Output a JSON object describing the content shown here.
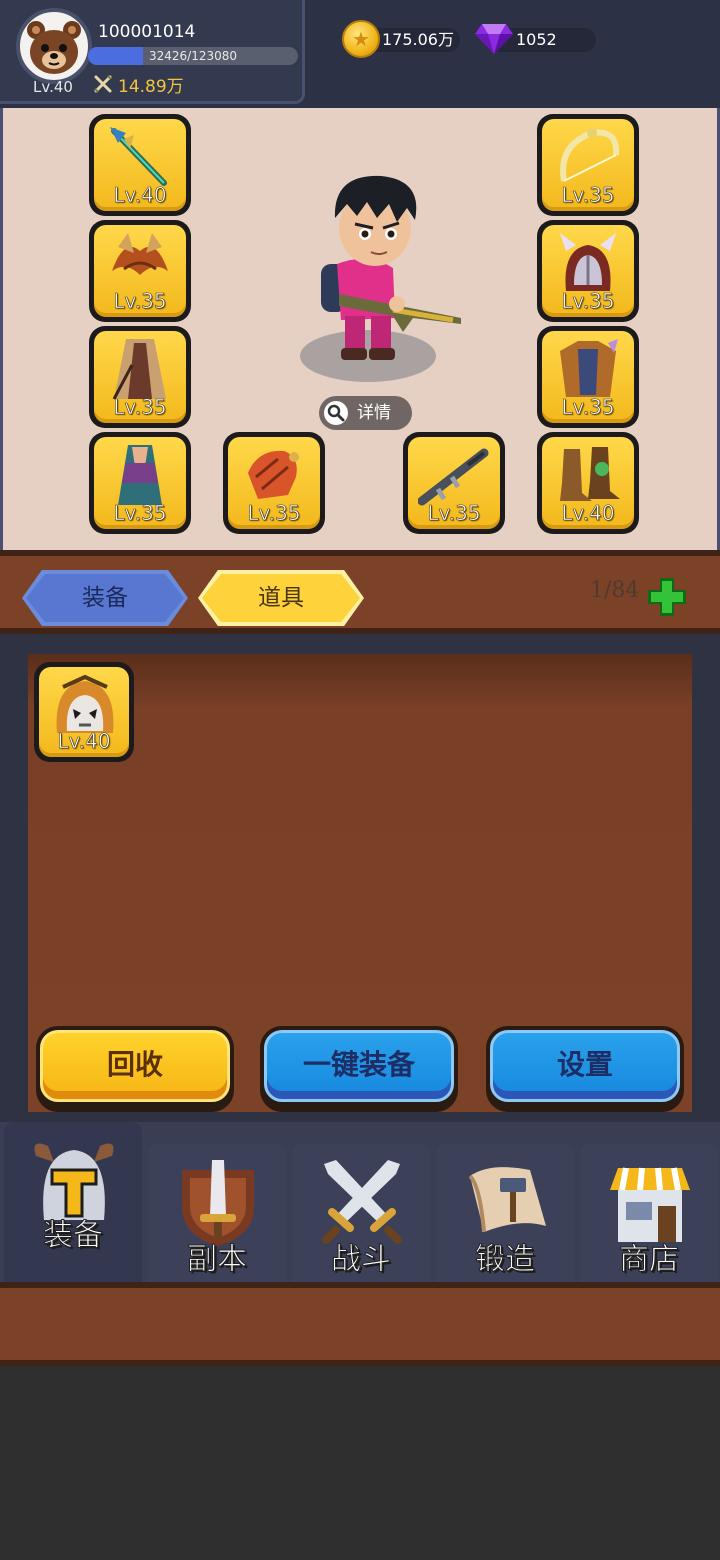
{
  "player": {
    "id": "100001014",
    "level": "Lv.40",
    "xp_text": "32426/123080",
    "xp_progress": 0.263,
    "power": "14.89万"
  },
  "currency": {
    "gold": "175.06万",
    "gems": "1052"
  },
  "equipment_slots": [
    {
      "name": "weapon-spear",
      "level": "Lv.40"
    },
    {
      "name": "shoulder-armor",
      "level": "Lv.35"
    },
    {
      "name": "cloak",
      "level": "Lv.35"
    },
    {
      "name": "robe",
      "level": "Lv.35"
    },
    {
      "name": "glove",
      "level": "Lv.35"
    },
    {
      "name": "rifle",
      "level": "Lv.35"
    },
    {
      "name": "boots",
      "level": "Lv.40"
    },
    {
      "name": "chest-armor",
      "level": "Lv.35"
    },
    {
      "name": "helmet",
      "level": "Lv.35"
    },
    {
      "name": "bow",
      "level": "Lv.35"
    }
  ],
  "detail_label": "详情",
  "tabs": {
    "equipment": "装备",
    "items": "道具"
  },
  "bag_count": "1/84",
  "inventory": [
    {
      "name": "skull-helmet",
      "level": "Lv.40"
    }
  ],
  "actions": {
    "recycle": "回收",
    "auto_equip": "一键装备",
    "settings": "设置"
  },
  "nav": [
    {
      "label": "装备",
      "icon": "helmet-icon",
      "active": true
    },
    {
      "label": "副本",
      "icon": "sword-shield-icon",
      "active": false
    },
    {
      "label": "战斗",
      "icon": "crossed-swords-icon",
      "active": false
    },
    {
      "label": "锻造",
      "icon": "hammer-scroll-icon",
      "active": false
    },
    {
      "label": "商店",
      "icon": "shop-icon",
      "active": false
    }
  ],
  "colors": {
    "accent_gold": "#fdd23b",
    "accent_blue": "#1688dd",
    "wood": "#7b4228",
    "slot_yellow": "#ffd84a"
  }
}
